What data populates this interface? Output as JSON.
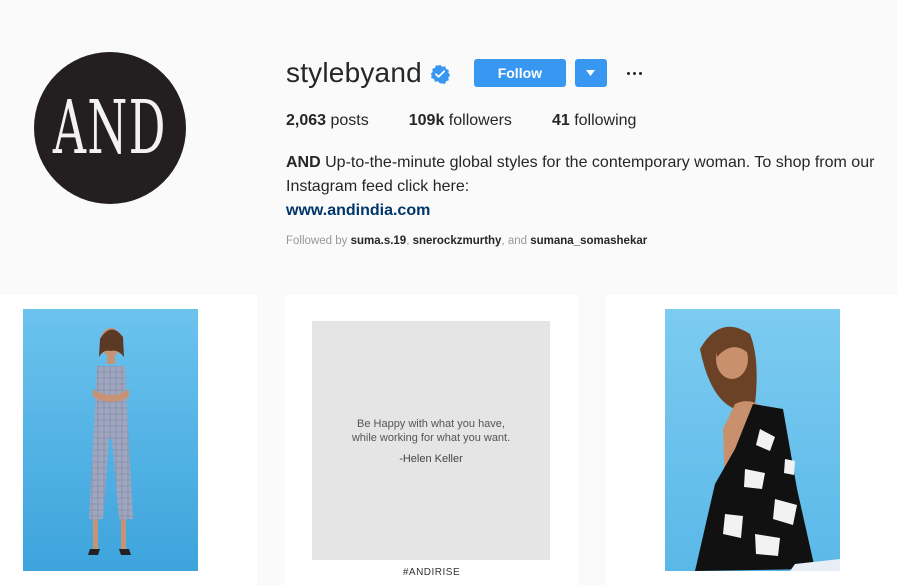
{
  "profile": {
    "avatar_text": "AND",
    "username": "stylebyand",
    "follow_label": "Follow",
    "stats": {
      "posts_count": "2,063",
      "posts_label": "posts",
      "followers_count": "109k",
      "followers_label": "followers",
      "following_count": "41",
      "following_label": "following"
    },
    "bio": {
      "name": "AND",
      "text": "Up-to-the-minute global styles for the contemporary woman. To shop from our Instagram feed click here:",
      "link": "www.andindia.com"
    },
    "followed_by": {
      "prefix": "Followed by",
      "user1": "suma.s.19",
      "sep1": ",",
      "user2": "snerockzmurthy",
      "sep2": ", and",
      "user3": "sumana_somashekar"
    }
  },
  "posts": {
    "quote_line1": "Be Happy with what you have,",
    "quote_line2": "while working for what you want.",
    "quote_author": "-Helen Keller",
    "hashtag": "#ANDIRISE"
  },
  "colors": {
    "follow_blue": "#3897f0",
    "verified_blue": "#3897f0",
    "link_blue": "#003569"
  },
  "icons": [
    "verified-badge-icon",
    "caret-down-icon",
    "more-options-icon"
  ]
}
